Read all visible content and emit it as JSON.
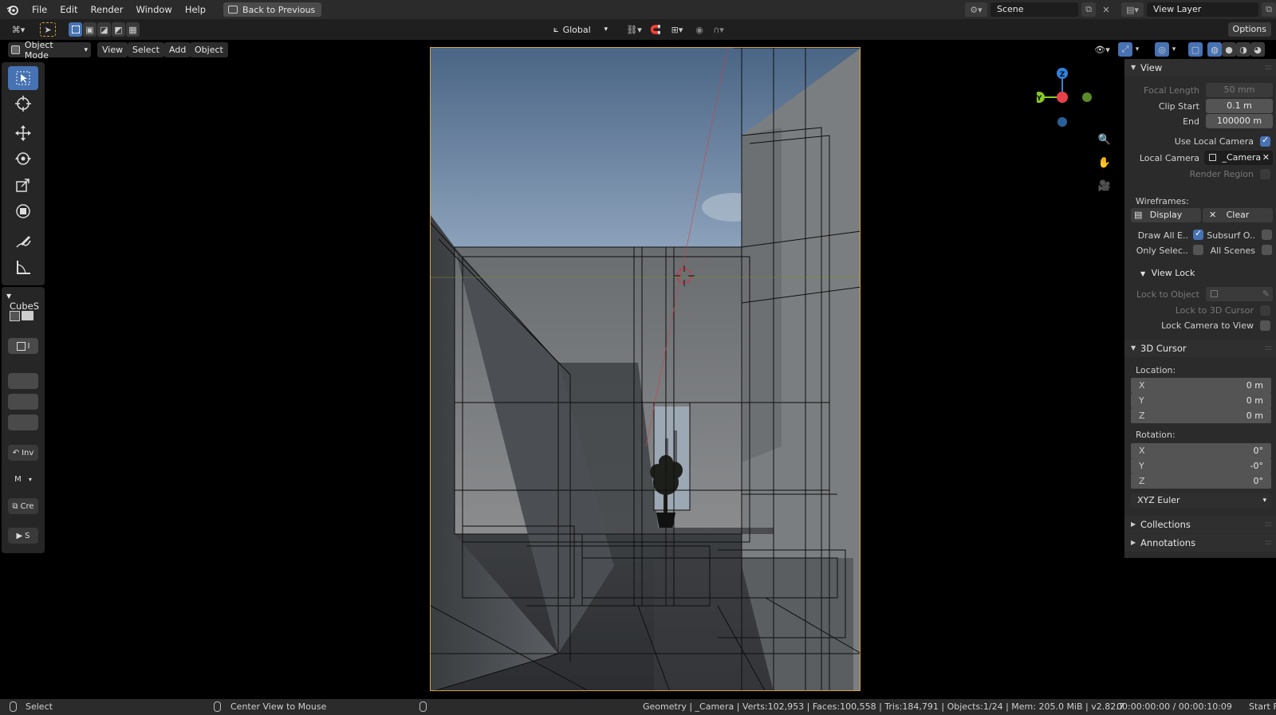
{
  "menubar": {
    "items": [
      "File",
      "Edit",
      "Render",
      "Window",
      "Help"
    ],
    "back_button": "Back to Previous",
    "scene": "Scene",
    "view_layer": "View Layer"
  },
  "toolheader": {
    "orientation": "Global",
    "options": "Options"
  },
  "viewport_header": {
    "mode": "Object Mode",
    "menus": [
      "View",
      "Select",
      "Add",
      "Object"
    ]
  },
  "left_panel": {
    "title": "CubeS",
    "item_labels": [
      "I",
      "Inv",
      "M",
      "Cre",
      "S"
    ]
  },
  "gizmo": {
    "x_label": "X",
    "y_label": "Y",
    "z_label": "Z",
    "colors": {
      "x": "#e8414b",
      "y": "#8ac926",
      "z": "#2f82e0"
    }
  },
  "sidebar": {
    "view": {
      "title": "View",
      "focal_length_label": "Focal Length",
      "focal_length": "50 mm",
      "clip_start_label": "Clip Start",
      "clip_start": "0.1 m",
      "end_label": "End",
      "end": "100000 m",
      "use_local_camera": "Use Local Camera",
      "local_camera_label": "Local Camera",
      "local_camera": "_Camera",
      "render_region": "Render Region"
    },
    "wireframes": {
      "title": "Wireframes:",
      "display": "Display",
      "clear": "Clear",
      "draw_all_edges": "Draw All E..",
      "subsurf": "Subsurf O..",
      "only_selected": "Only Selec..",
      "all_scenes": "All Scenes"
    },
    "view_lock": {
      "title": "View Lock",
      "lock_to_object": "Lock to Object",
      "lock_to_cursor": "Lock to 3D Cursor",
      "lock_camera": "Lock Camera to View"
    },
    "cursor": {
      "title": "3D Cursor",
      "location_label": "Location:",
      "location": [
        {
          "axis": "X",
          "value": "0 m"
        },
        {
          "axis": "Y",
          "value": "0 m"
        },
        {
          "axis": "Z",
          "value": "0 m"
        }
      ],
      "rotation_label": "Rotation:",
      "rotation": [
        {
          "axis": "X",
          "value": "0°"
        },
        {
          "axis": "Y",
          "value": "-0°"
        },
        {
          "axis": "Z",
          "value": "0°"
        }
      ],
      "rotation_mode": "XYZ Euler"
    },
    "collections": "Collections",
    "annotations": "Annotations"
  },
  "statusbar": {
    "select": "Select",
    "center_view": "Center View to Mouse",
    "stats": "Geometry | _Camera | Verts:102,953 | Faces:100,558 | Tris:184,791 | Objects:1/24 | Mem: 205.0 MiB | v2.82.7",
    "time": "00:00:00:00 / 00:00:10:09",
    "start": "Start F"
  }
}
